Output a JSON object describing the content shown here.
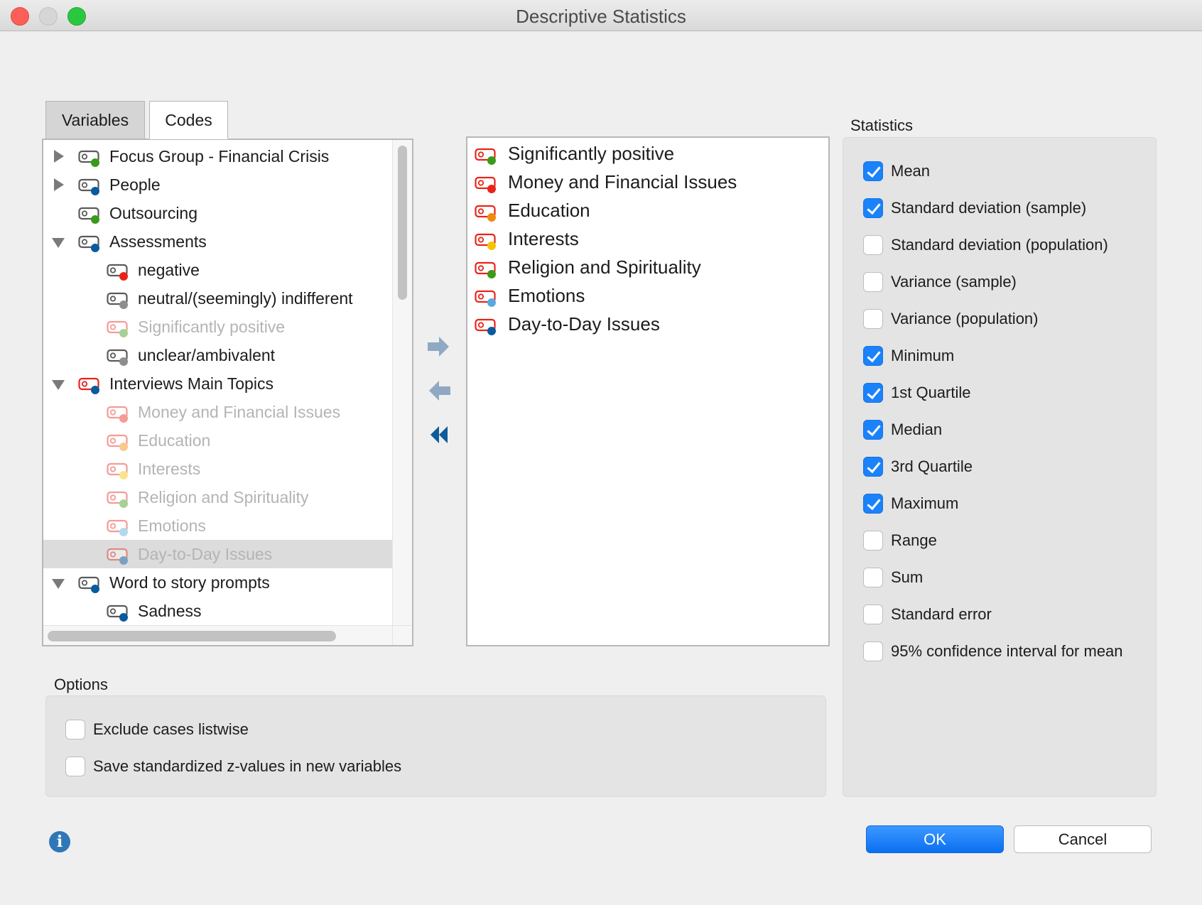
{
  "window": {
    "title": "Descriptive Statistics"
  },
  "tabs": [
    {
      "label": "Variables",
      "active": false
    },
    {
      "label": "Codes",
      "active": true
    }
  ],
  "tree": {
    "items": [
      {
        "label": "Focus Group - Financial Crisis",
        "expander": "collapsed",
        "icon_color": "#3a9a1a",
        "dimmed": false,
        "selected": false
      },
      {
        "label": "People",
        "expander": "collapsed",
        "icon_color": "#0a5aa0",
        "dimmed": false,
        "selected": false
      },
      {
        "label": "Outsourcing",
        "expander": "none",
        "icon_color": "#3a9a1a",
        "dimmed": false,
        "selected": false
      },
      {
        "label": "Assessments",
        "expander": "expanded",
        "icon_color": "#0a5aa0",
        "dimmed": false,
        "selected": false
      },
      {
        "label": "negative",
        "expander": "none",
        "icon_color": "#e8241a",
        "dimmed": false,
        "selected": false
      },
      {
        "label": "neutral/(seemingly) indifferent",
        "expander": "none",
        "icon_color": "#8e8e8e",
        "dimmed": false,
        "selected": false
      },
      {
        "label": "Significantly positive",
        "expander": "none",
        "icon_color": "#3a9a1a",
        "dimmed": true,
        "selected": false
      },
      {
        "label": "unclear/ambivalent",
        "expander": "none",
        "icon_color": "#8e8e8e",
        "dimmed": false,
        "selected": false
      },
      {
        "label": "Interviews Main Topics",
        "expander": "expanded",
        "icon_color": "#0a5aa0",
        "dimmed": false,
        "selected": false
      },
      {
        "label": "Money and Financial Issues",
        "expander": "none",
        "icon_color": "#e8241a",
        "dimmed": true,
        "selected": false
      },
      {
        "label": "Education",
        "expander": "none",
        "icon_color": "#f08a0a",
        "dimmed": true,
        "selected": false
      },
      {
        "label": "Interests",
        "expander": "none",
        "icon_color": "#f5c400",
        "dimmed": true,
        "selected": false
      },
      {
        "label": "Religion and Spirituality",
        "expander": "none",
        "icon_color": "#3a9a1a",
        "dimmed": true,
        "selected": false
      },
      {
        "label": "Emotions",
        "expander": "none",
        "icon_color": "#5aa8e0",
        "dimmed": true,
        "selected": false
      },
      {
        "label": "Day-to-Day Issues",
        "expander": "none",
        "icon_color": "#0a5aa0",
        "dimmed": true,
        "selected": true
      },
      {
        "label": "Word to story prompts",
        "expander": "expanded",
        "icon_color": "#0a5aa0",
        "dimmed": false,
        "selected": false
      },
      {
        "label": "Sadness",
        "expander": "none",
        "icon_color": "#0a5aa0",
        "dimmed": false,
        "selected": false
      }
    ]
  },
  "move_buttons": {
    "add_icon": "arrow-right-icon",
    "remove_icon": "arrow-left-icon",
    "remove_all_icon": "double-chevron-left-icon"
  },
  "selected_list": [
    {
      "label": "Significantly positive",
      "icon_color": "#3a9a1a"
    },
    {
      "label": "Money and Financial Issues",
      "icon_color": "#e8241a"
    },
    {
      "label": "Education",
      "icon_color": "#f08a0a"
    },
    {
      "label": "Interests",
      "icon_color": "#f5c400"
    },
    {
      "label": "Religion and Spirituality",
      "icon_color": "#3a9a1a"
    },
    {
      "label": "Emotions",
      "icon_color": "#5aa8e0"
    },
    {
      "label": "Day-to-Day Issues",
      "icon_color": "#0a5aa0"
    }
  ],
  "statistics": {
    "heading": "Statistics",
    "items": [
      {
        "label": "Mean",
        "checked": true
      },
      {
        "label": "Standard deviation (sample)",
        "checked": true
      },
      {
        "label": "Standard deviation (population)",
        "checked": false
      },
      {
        "label": "Variance (sample)",
        "checked": false
      },
      {
        "label": "Variance (population)",
        "checked": false
      },
      {
        "label": "Minimum",
        "checked": true
      },
      {
        "label": "1st Quartile",
        "checked": true
      },
      {
        "label": "Median",
        "checked": true
      },
      {
        "label": "3rd Quartile",
        "checked": true
      },
      {
        "label": "Maximum",
        "checked": true
      },
      {
        "label": "Range",
        "checked": false
      },
      {
        "label": "Sum",
        "checked": false
      },
      {
        "label": "Standard error",
        "checked": false
      },
      {
        "label": "95% confidence interval for mean",
        "checked": false
      }
    ]
  },
  "options": {
    "heading": "Options",
    "items": [
      {
        "label": "Exclude cases listwise",
        "checked": false
      },
      {
        "label": "Save standardized z-values in new variables",
        "checked": false
      }
    ]
  },
  "buttons": {
    "ok": "OK",
    "cancel": "Cancel",
    "info_icon": "info-icon"
  },
  "colors": {
    "accent": "#1a82fb",
    "code_outline_gray": "#5a5a5a",
    "code_outline_red": "#e8241a"
  }
}
